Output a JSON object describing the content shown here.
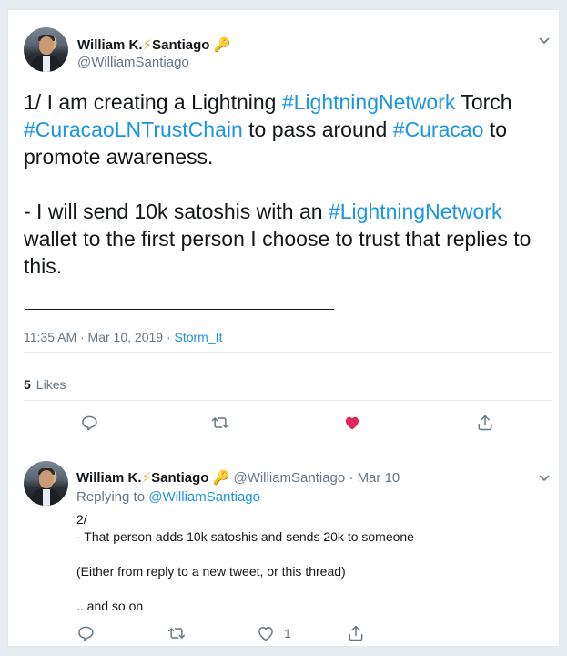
{
  "main_tweet": {
    "display_name": "William K.",
    "display_name_bolt": "⚡",
    "display_name_rest": "Santiago",
    "display_name_key": "🔑",
    "handle": "@WilliamSantiago",
    "text": {
      "l1_a": "1/ I am creating a Lightning  ",
      "l1_tag": "#LightningNetwork",
      "l1_b": " Torch",
      "l2_tag": "#CuracaoLNTrustChain",
      "l2_b": " to pass around ",
      "l2_tag2": "#Curacao",
      "l2_c": " to",
      "l3": "promote awareness.",
      "l4_a": "- I will send 10k satoshis with an ",
      "l4_tag": "#LightningNetwork",
      "l5": "wallet to the first person I choose to trust that replies to",
      "l6": "this."
    },
    "timestamp": "11:35 AM · Mar 10, 2019 · ",
    "source": "Storm_It",
    "likes_count": "5",
    "likes_label": "Likes",
    "liked": true
  },
  "reply_tweet": {
    "display_name": "William K.",
    "display_name_bolt": "⚡",
    "display_name_rest": "Santiago",
    "display_name_key": "🔑",
    "handle_date": " @WilliamSantiago · Mar 10",
    "replying_prefix": "Replying to ",
    "replying_to": "@WilliamSantiago",
    "lines": {
      "l1": "2/",
      "l2": "- That person adds 10k satoshis and sends 20k to someone",
      "l3": "(Either from reply to a new tweet, or this thread)",
      "l4": " .. and so on"
    },
    "like_count": "1"
  },
  "icons": [
    "chevron-down-icon",
    "reply-icon",
    "retweet-icon",
    "heart-icon",
    "share-icon"
  ],
  "colors": {
    "link": "#1b95e0",
    "like": "#e0245e",
    "muted": "#657786"
  }
}
